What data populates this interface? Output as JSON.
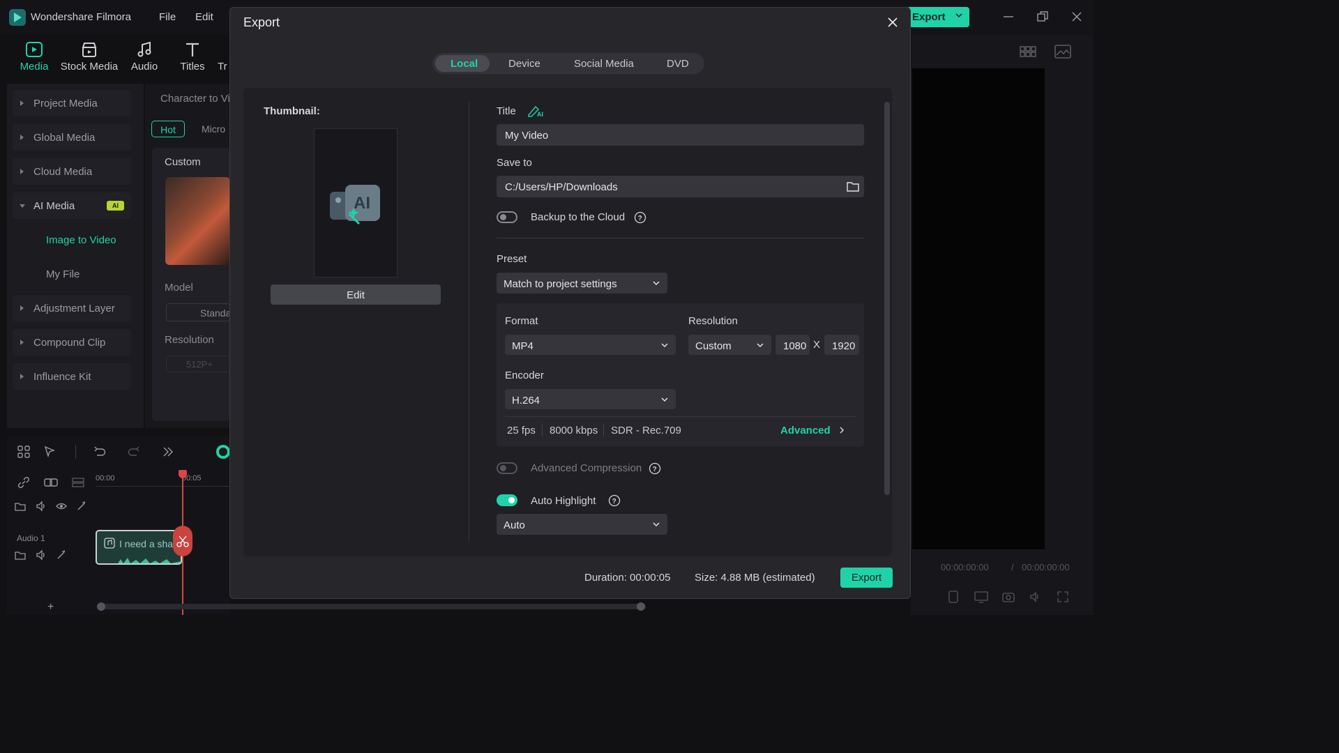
{
  "app": {
    "title": "Wondershare Filmora",
    "menu": [
      "File",
      "Edit"
    ],
    "export_label": "Export"
  },
  "toolbar": {
    "items": [
      {
        "label": "Media",
        "icon": "media-icon",
        "active": true
      },
      {
        "label": "Stock Media",
        "icon": "stock-media-icon"
      },
      {
        "label": "Audio",
        "icon": "music-note-icon"
      },
      {
        "label": "Titles",
        "icon": "titles-icon"
      },
      {
        "label": "Tr",
        "icon": "transitions-icon"
      }
    ]
  },
  "sidebar": {
    "items": [
      {
        "label": "Project Media"
      },
      {
        "label": "Global Media"
      },
      {
        "label": "Cloud Media"
      },
      {
        "label": "AI Media",
        "badge": "AI",
        "expanded": true
      },
      {
        "label": "Adjustment Layer"
      },
      {
        "label": "Compound Clip"
      },
      {
        "label": "Influence Kit"
      }
    ],
    "sub_items": [
      {
        "label": "Image to Video",
        "active": true
      },
      {
        "label": "My File"
      }
    ]
  },
  "mid_panel": {
    "heading": "Character to Vi",
    "tabs": [
      "Hot",
      "Micro"
    ],
    "custom_label": "Custom",
    "model_label": "Model",
    "model_value": "Standa",
    "resolution_label": "Resolution",
    "resolution_value": "512P+"
  },
  "timeline": {
    "time_start": "00:00",
    "time_mark": "00:05",
    "audio_track": "Audio 1",
    "clip_text": "I need a sha"
  },
  "preview": {
    "current_time": "00:00:00:00",
    "separator": "/",
    "total_time": "00:00:00:00"
  },
  "dialog": {
    "title": "Export",
    "tabs": [
      {
        "label": "Local",
        "active": true
      },
      {
        "label": "Device"
      },
      {
        "label": "Social Media"
      },
      {
        "label": "DVD"
      }
    ],
    "thumbnail_label": "Thumbnail:",
    "edit_label": "Edit",
    "title_label": "Title",
    "title_value": "My Video",
    "save_to_label": "Save to",
    "save_to_value": "C:/Users/HP/Downloads",
    "backup_label": "Backup to the Cloud",
    "backup_on": false,
    "preset_label": "Preset",
    "preset_value": "Match to project settings",
    "format_label": "Format",
    "format_value": "MP4",
    "resolution_label": "Resolution",
    "resolution_value": "Custom",
    "width": "1080",
    "x_label": "X",
    "height": "1920",
    "encoder_label": "Encoder",
    "encoder_value": "H.264",
    "fps": "25 fps",
    "bitrate": "8000 kbps",
    "color_space": "SDR - Rec.709",
    "advanced_label": "Advanced",
    "advanced_compression_label": "Advanced Compression",
    "advanced_compression_on": false,
    "auto_highlight_label": "Auto Highlight",
    "auto_highlight_on": true,
    "auto_highlight_value": "Auto",
    "duration_label": "Duration:",
    "duration_value": "00:00:05",
    "size_label": "Size:",
    "size_value": "4.88 MB (estimated)",
    "export_label": "Export"
  },
  "colors": {
    "accent": "#1fd3a8",
    "ai_badge": "#b6d534",
    "dialog_bg": "#26262b"
  }
}
